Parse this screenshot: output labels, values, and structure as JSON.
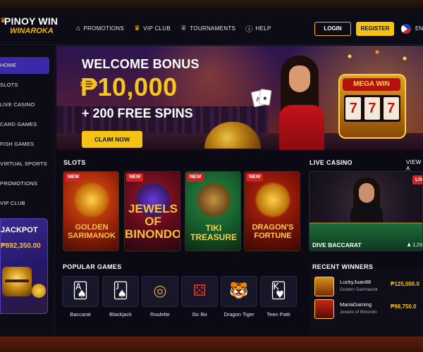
{
  "brand": {
    "name": "PINOY WIN",
    "tagline": "WINAROKA"
  },
  "nav": {
    "items": [
      {
        "label": "PROMOTIONS",
        "icon": "gift-icon"
      },
      {
        "label": "VIP CLUB",
        "icon": "crown-icon"
      },
      {
        "label": "TOURNAMENTS",
        "icon": "trophy-icon"
      },
      {
        "label": "HELP",
        "icon": "question-icon"
      }
    ],
    "login_label": "LOGIN",
    "register_label": "REGISTER",
    "language": "EN"
  },
  "sidebar": {
    "items": [
      {
        "label": "HOME",
        "active": true
      },
      {
        "label": "SLOTS"
      },
      {
        "label": "LIVE CASINO"
      },
      {
        "label": "CARD GAMES"
      },
      {
        "label": "FISH GAMES"
      },
      {
        "label": "VIRTUAL SPORTS"
      },
      {
        "label": "PROMOTIONS"
      },
      {
        "label": "VIP CLUB"
      }
    ],
    "jackpot": {
      "title": "JACKPOT",
      "amount": "₱892,350.00"
    }
  },
  "hero": {
    "title": "WELCOME BONUS",
    "amount": "₱10,000",
    "spins": "+ 200 FREE SPINS",
    "cta": "CLAIM NOW",
    "slot_sign": "MEGA WIN",
    "reels": [
      "7",
      "7",
      "7"
    ]
  },
  "slots": {
    "title": "SLOTS",
    "games": [
      {
        "badge": "NEW",
        "name": "GOLDEN SARIMANOK",
        "accent": "#f4c542"
      },
      {
        "badge": "NEW",
        "name": "JEWELS OF BINONDO",
        "accent": "#f2c23a"
      },
      {
        "badge": "NEW",
        "name": "TIKI TREASURE",
        "accent": "#f4d24a"
      },
      {
        "badge": "NEW",
        "name": "DRAGON'S FORTUNE",
        "accent": "#ffd24a"
      }
    ]
  },
  "live_casino": {
    "title": "LIVE CASINO",
    "view_all": "VIEW A",
    "badge": "LIVE",
    "game": "DIVE BACCARAT",
    "count": "1,23"
  },
  "popular_games": {
    "title": "POPULAR GAMES",
    "items": [
      {
        "label": "Baccarat",
        "icon": "cards-icon"
      },
      {
        "label": "Blackjack",
        "icon": "blackjack-icon"
      },
      {
        "label": "Roulette",
        "icon": "roulette-icon"
      },
      {
        "label": "Sic Bo",
        "icon": "dice-icon"
      },
      {
        "label": "Dragon Tiger",
        "icon": "tiger-icon"
      },
      {
        "label": "Teen Patti",
        "icon": "teen-patti-icon"
      }
    ]
  },
  "winners": {
    "title": "RECENT WINNERS",
    "items": [
      {
        "user": "LuckyJuan88",
        "game": "Golden Sarimanok",
        "amount": "₱125,000.0"
      },
      {
        "user": "MariaGaming",
        "game": "Jewels of Binondo",
        "amount": "₱98,750.0"
      }
    ]
  },
  "colors": {
    "accent": "#f5c316",
    "active_nav": "#3b2aa8",
    "badge_red": "#d81e1e"
  }
}
